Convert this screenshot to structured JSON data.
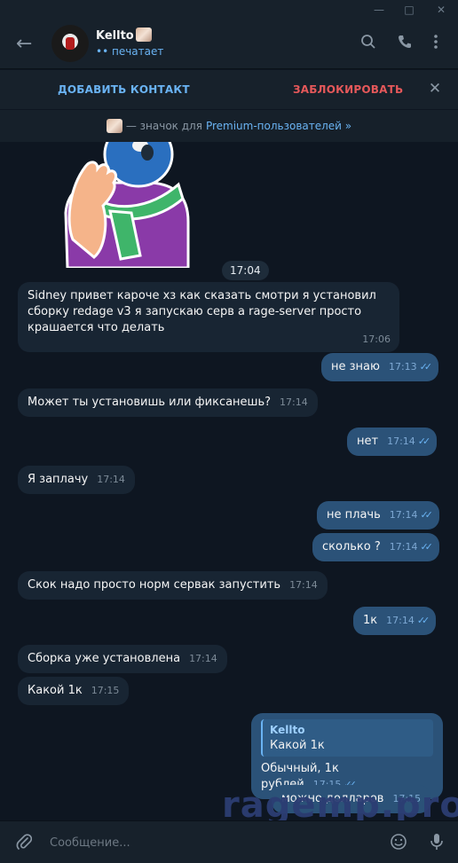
{
  "window": {
    "minimize_icon": "minimize-icon",
    "maximize_icon": "maximize-icon",
    "close_icon": "close-icon"
  },
  "header": {
    "name": "Kellto",
    "status": "•• печатает"
  },
  "action_bar": {
    "add_contact": "ДОБАВИТЬ КОНТАКТ",
    "block": "ЗАБЛОКИРОВАТЬ"
  },
  "premium": {
    "text": "— значок для",
    "link": "Premium-пользователей »"
  },
  "sticker_time": "17:04",
  "messages": [
    {
      "text": "Sidney привет кароче хз как сказать смотри я установил сборку redage v3 я запускаю серв а rage-server просто крашается что делать",
      "time": "17:06"
    },
    {
      "text": "не знаю",
      "time": "17:13",
      "ticks": "✓✓"
    },
    {
      "text": "Может ты установишь или фиксанешь?",
      "time": "17:14"
    },
    {
      "text": "нет",
      "time": "17:14",
      "ticks": "✓✓"
    },
    {
      "text": "Я заплачу",
      "time": "17:14"
    },
    {
      "text": "не плачь",
      "time": "17:14",
      "ticks": "✓✓"
    },
    {
      "text": "сколько ?",
      "time": "17:14",
      "ticks": "✓✓"
    },
    {
      "text": "Скок надо просто норм сервак запустить",
      "time": "17:14"
    },
    {
      "text": "1к",
      "time": "17:14",
      "ticks": "✓✓"
    },
    {
      "text": "Сборка уже установлена",
      "time": "17:14"
    },
    {
      "text": "Какой 1к",
      "time": "17:15"
    },
    {
      "reply_name": "Kellto",
      "reply_text": "Какой 1к",
      "text": "Обычный, 1к рублей",
      "time": "17:15",
      "ticks": "✓✓"
    },
    {
      "text": "можно долларов",
      "time": "17:15"
    }
  ],
  "composer": {
    "placeholder": "Сообщение..."
  },
  "watermark": "ragemp.pro"
}
